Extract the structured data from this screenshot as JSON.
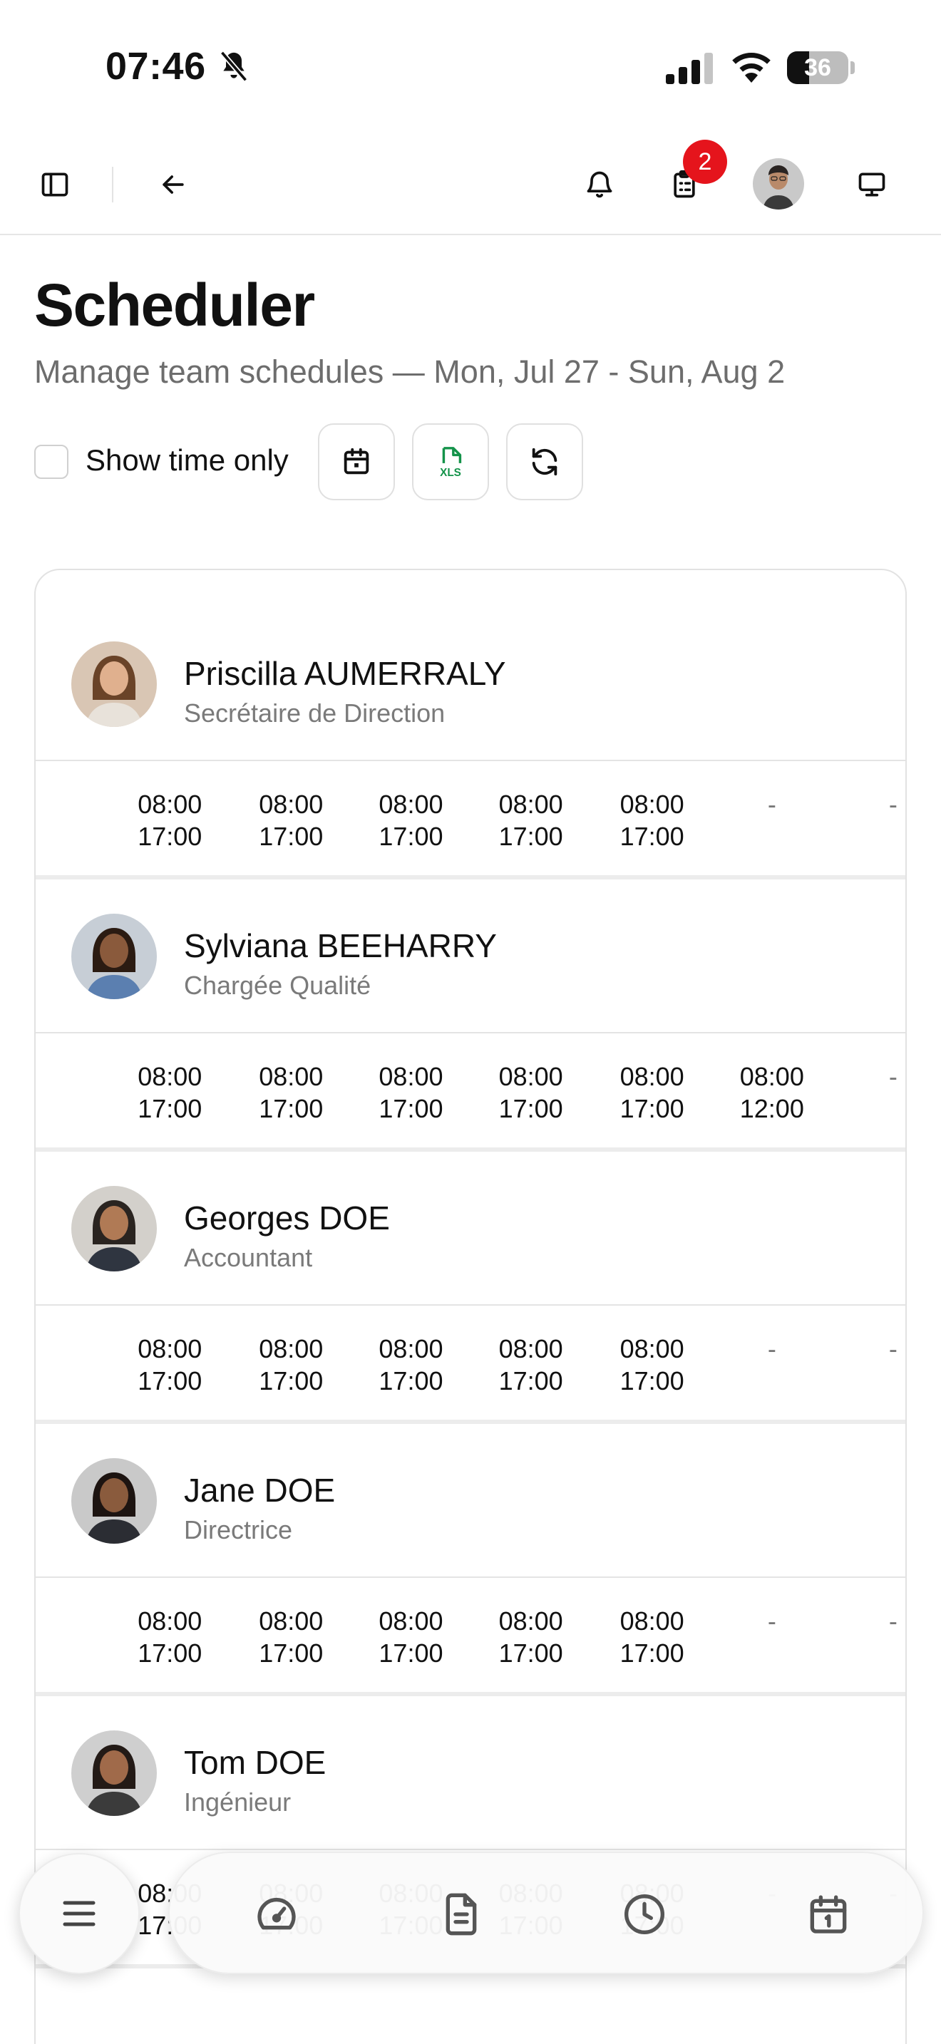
{
  "status_bar": {
    "time": "07:46",
    "battery_level": "36",
    "battery_fraction": 0.36
  },
  "header": {
    "icons": [
      "sidebar-toggle-icon",
      "arrow-left-icon",
      "bell-icon",
      "clipboard-icon",
      "user-avatar",
      "monitor-icon"
    ],
    "tasks_badge": "2"
  },
  "page": {
    "title": "Scheduler",
    "subtitle": "Manage team schedules — Mon, Jul 27 - Sun, Aug 2"
  },
  "toolbar": {
    "show_time_only_label": "Show time only",
    "show_time_only_checked": false,
    "buttons": [
      "calendar-icon",
      "xls-export-icon",
      "refresh-icon"
    ],
    "xls_label": "XLS",
    "xls_color": "#14934a"
  },
  "employees": [
    {
      "name": "Priscilla AUMERRALY",
      "role": "Secrétaire de Direction",
      "days": [
        {
          "start": "08:00",
          "end": "17:00"
        },
        {
          "start": "08:00",
          "end": "17:00"
        },
        {
          "start": "08:00",
          "end": "17:00"
        },
        {
          "start": "08:00",
          "end": "17:00"
        },
        {
          "start": "08:00",
          "end": "17:00"
        },
        {
          "start": "-",
          "end": ""
        },
        {
          "start": "-",
          "end": ""
        }
      ]
    },
    {
      "name": "Sylviana BEEHARRY",
      "role": "Chargée Qualité",
      "days": [
        {
          "start": "08:00",
          "end": "17:00"
        },
        {
          "start": "08:00",
          "end": "17:00"
        },
        {
          "start": "08:00",
          "end": "17:00"
        },
        {
          "start": "08:00",
          "end": "17:00"
        },
        {
          "start": "08:00",
          "end": "17:00"
        },
        {
          "start": "08:00",
          "end": "12:00"
        },
        {
          "start": "-",
          "end": ""
        }
      ]
    },
    {
      "name": "Georges DOE",
      "role": "Accountant",
      "days": [
        {
          "start": "08:00",
          "end": "17:00"
        },
        {
          "start": "08:00",
          "end": "17:00"
        },
        {
          "start": "08:00",
          "end": "17:00"
        },
        {
          "start": "08:00",
          "end": "17:00"
        },
        {
          "start": "08:00",
          "end": "17:00"
        },
        {
          "start": "-",
          "end": ""
        },
        {
          "start": "-",
          "end": ""
        }
      ]
    },
    {
      "name": "Jane DOE",
      "role": "Directrice",
      "days": [
        {
          "start": "08:00",
          "end": "17:00"
        },
        {
          "start": "08:00",
          "end": "17:00"
        },
        {
          "start": "08:00",
          "end": "17:00"
        },
        {
          "start": "08:00",
          "end": "17:00"
        },
        {
          "start": "08:00",
          "end": "17:00"
        },
        {
          "start": "-",
          "end": ""
        },
        {
          "start": "-",
          "end": ""
        }
      ]
    },
    {
      "name": "Tom DOE",
      "role": "Ingénieur",
      "days": [
        {
          "start": "08:00",
          "end": "17:00"
        },
        {
          "start": "08:00",
          "end": "17:00"
        },
        {
          "start": "08:00",
          "end": "17:00"
        },
        {
          "start": "08:00",
          "end": "17:00"
        },
        {
          "start": "08:00",
          "end": "17:00"
        },
        {
          "start": "-",
          "end": ""
        },
        {
          "start": "-",
          "end": ""
        }
      ]
    }
  ],
  "bottom_nav": {
    "menu_icon": "hamburger-menu-icon",
    "items": [
      "dashboard-gauge-icon",
      "document-icon",
      "clock-icon",
      "calendar-icon"
    ]
  }
}
